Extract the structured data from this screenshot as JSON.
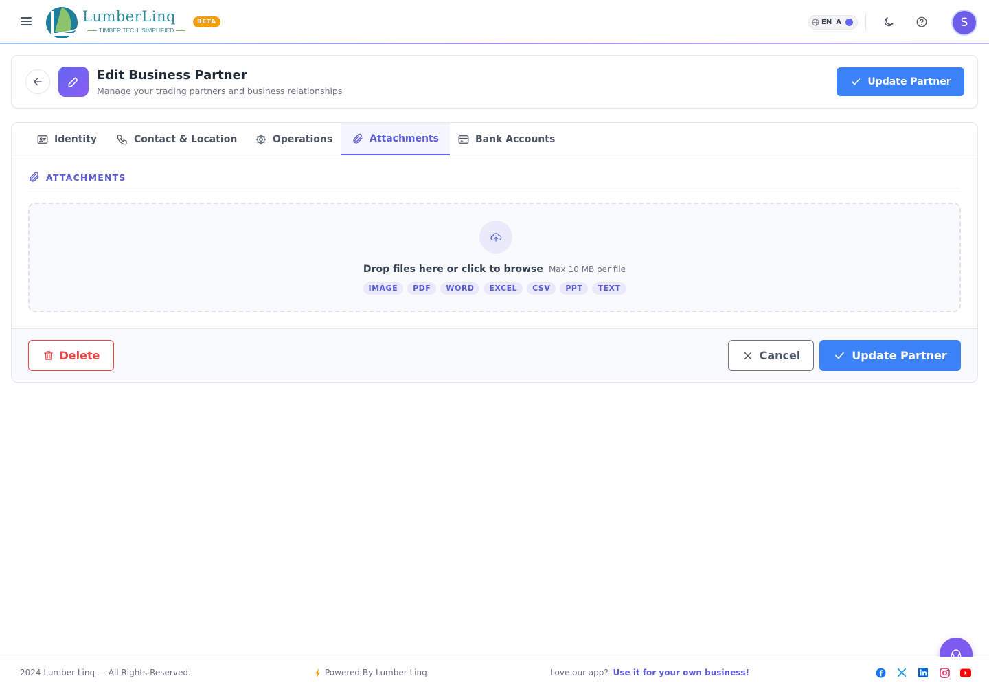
{
  "brand": {
    "name": "LumberLinq",
    "tagline": "TIMBER TECH, SIMPLIFIED",
    "badge": "BETA"
  },
  "topbar": {
    "language_code": "EN",
    "language_alt": "A",
    "avatar_initial": "S"
  },
  "header": {
    "title": "Edit Business Partner",
    "subtitle": "Manage your trading partners and business relationships",
    "update_label": "Update Partner"
  },
  "tabs": [
    {
      "label": "Identity",
      "icon": "id-card-icon",
      "active": false
    },
    {
      "label": "Contact & Location",
      "icon": "phone-icon",
      "active": false
    },
    {
      "label": "Operations",
      "icon": "gear-icon",
      "active": false
    },
    {
      "label": "Attachments",
      "icon": "paperclip-icon",
      "active": true
    },
    {
      "label": "Bank Accounts",
      "icon": "credit-card-icon",
      "active": false
    }
  ],
  "attachments": {
    "section_title": "ATTACHMENTS",
    "drop_text": "Drop files here or click to browse",
    "limit_text": "Max 10 MB per file",
    "file_types": [
      "IMAGE",
      "PDF",
      "WORD",
      "EXCEL",
      "CSV",
      "PPT",
      "TEXT"
    ]
  },
  "actions": {
    "delete_label": "Delete",
    "cancel_label": "Cancel",
    "update_label": "Update Partner"
  },
  "footer": {
    "copyright": "2024 Lumber Linq — All Rights Reserved.",
    "powered": "Powered By Lumber Linq",
    "promo_text": "Love our app?",
    "promo_link": "Use it for your own business!",
    "socials": [
      "facebook-icon",
      "x-icon",
      "linkedin-icon",
      "instagram-icon",
      "youtube-icon"
    ]
  },
  "colors": {
    "accent": "#6366f1",
    "primary": "#3b82f6",
    "danger": "#ef4444",
    "beta": "#f59e0b"
  }
}
